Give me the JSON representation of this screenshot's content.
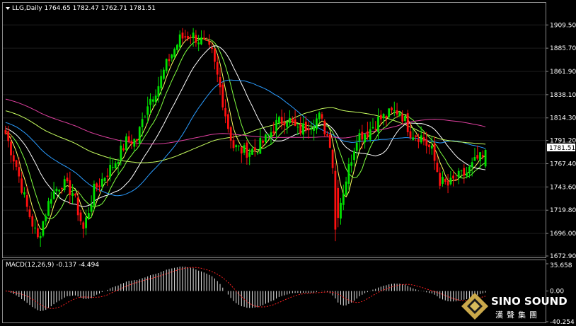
{
  "header": {
    "symbol_line": "LLG,Daily  1764.65 1782.47 1762.71 1781.51",
    "symbol": "LLG,Daily",
    "open": 1764.65,
    "high": 1782.47,
    "low": 1762.71,
    "close": 1781.51
  },
  "macd_header": "MACD(12,26,9) -0.137 -4.494",
  "price_tag": "1781.51",
  "logo": {
    "text": "SINO SOUND",
    "cn": "漢聲集團"
  },
  "colors": {
    "bull": "#00e000",
    "bear": "#ff1010",
    "grid": "#1e1e1e",
    "ma_white": "#ffffff",
    "ma_yellow": "#ffff60",
    "ma_lime": "#80ff40",
    "ma_blue": "#2a9cff",
    "ma_magenta": "#e040a0",
    "ma_yellowgreen": "#c8ff60",
    "macd_hist": "#e6e6e6",
    "macd_signal": "#ff2020"
  },
  "chart_data": {
    "type": "candlestick",
    "price_axis": {
      "ticks": [
        1909.5,
        1885.7,
        1861.9,
        1838.1,
        1814.3,
        1791.2,
        1767.4,
        1743.6,
        1719.8,
        1696.0,
        1672.9
      ],
      "range": [
        1672.9,
        1922.0
      ]
    },
    "macd_axis": {
      "ticks": [
        35.658,
        0.0,
        -40.254
      ],
      "range": [
        -40.254,
        35.658
      ]
    },
    "candles_ohlc": [],
    "macd_hist": [],
    "macd_signal": [],
    "moving_averages": []
  }
}
